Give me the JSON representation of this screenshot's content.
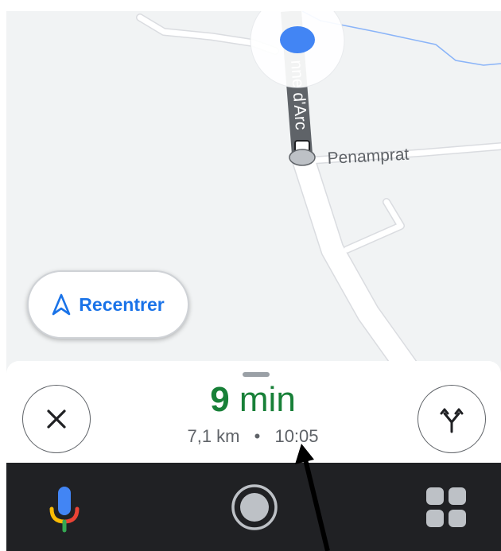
{
  "map": {
    "streets": [
      {
        "name": "Rue Jeanne d'Arc",
        "visible_text": "nne d'Arc"
      },
      {
        "name": "Penamprat",
        "visible_text": "Penamprat"
      }
    ],
    "colors": {
      "background": "#f1f3f4",
      "road": "#ffffff",
      "route": "#5f6368",
      "location": "#4285f4",
      "waterway": "#8ab4f8"
    }
  },
  "recenter": {
    "label": "Recentrer",
    "icon": "navigation-arrow-icon"
  },
  "trip": {
    "eta_number": "9",
    "eta_unit": "min",
    "distance": "7,1 km",
    "separator": "•",
    "arrival_time": "10:05"
  },
  "buttons": {
    "close_icon": "close-icon",
    "alt_routes_icon": "alt-routes-icon"
  },
  "navbar": {
    "mic_icon": "google-mic-icon",
    "home_icon": "home-circle-icon",
    "apps_icon": "app-grid-icon"
  },
  "colors": {
    "eta_green": "#188038",
    "accent_blue": "#1a73e8",
    "navbar": "#202124"
  }
}
